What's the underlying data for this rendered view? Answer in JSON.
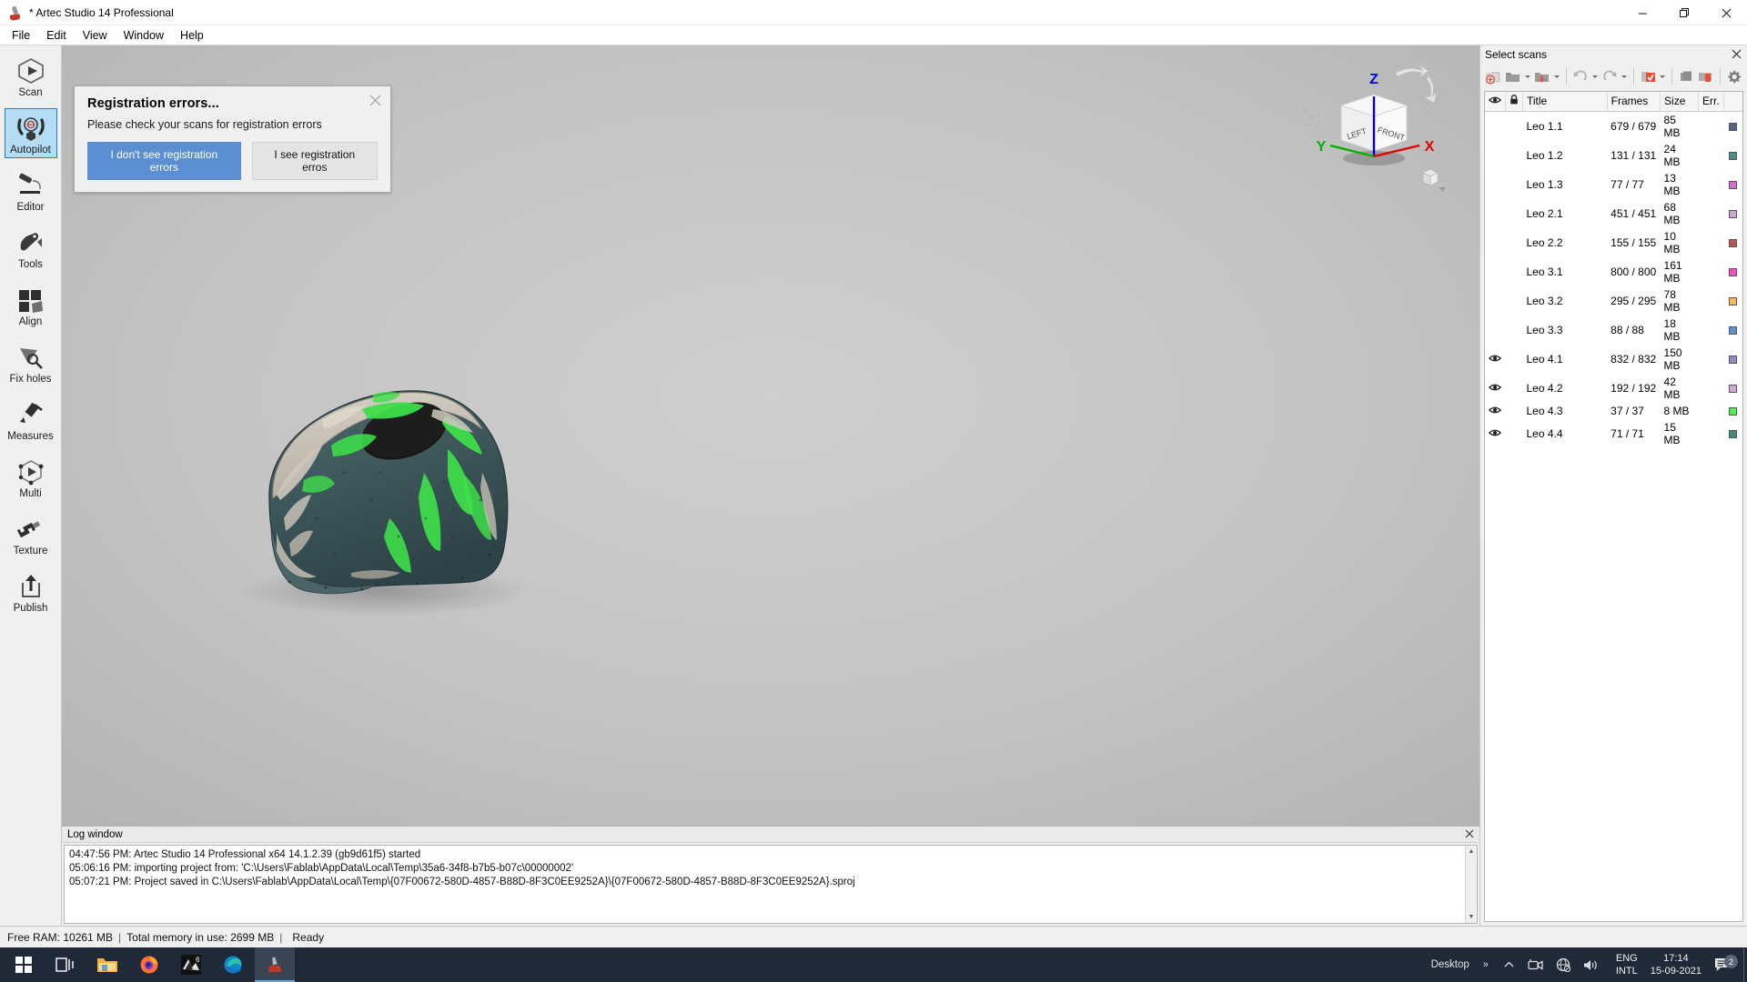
{
  "window": {
    "title": "* Artec Studio 14 Professional",
    "icon": "artec-app-icon",
    "controls": {
      "minimize": "—",
      "maximize": "❐",
      "close": "✕"
    }
  },
  "menubar": {
    "items": [
      "File",
      "Edit",
      "View",
      "Window",
      "Help"
    ]
  },
  "sidebar": {
    "items": [
      {
        "label": "Scan",
        "icon": "scan-icon",
        "active": false
      },
      {
        "label": "Autopilot",
        "icon": "autopilot-icon",
        "active": true
      },
      {
        "label": "Editor",
        "icon": "editor-icon",
        "active": false
      },
      {
        "label": "Tools",
        "icon": "tools-icon",
        "active": false
      },
      {
        "label": "Align",
        "icon": "align-icon",
        "active": false
      },
      {
        "label": "Fix holes",
        "icon": "fix-holes-icon",
        "active": false
      },
      {
        "label": "Measures",
        "icon": "measures-icon",
        "active": false
      },
      {
        "label": "Multi",
        "icon": "multi-icon",
        "active": false
      },
      {
        "label": "Texture",
        "icon": "texture-icon",
        "active": false
      },
      {
        "label": "Publish",
        "icon": "publish-icon",
        "active": false
      }
    ]
  },
  "toast": {
    "title": "Registration errors...",
    "message": "Please check your scans for registration errors",
    "primary_button": "I don't see registration errors",
    "secondary_button": "I see registration erros",
    "close_icon": "close-icon",
    "primary_color": "#5b8fd1"
  },
  "gizmo": {
    "axis_x": "X",
    "axis_y": "Y",
    "axis_z": "Z",
    "face_left": "LEFT",
    "face_front": "FRONT",
    "axis_x_color": "#e00000",
    "axis_y_color": "#00b000",
    "axis_z_color": "#0000d8"
  },
  "scan_panel": {
    "title": "Select scans",
    "close_icon": "close-icon",
    "toolbar": [
      {
        "name": "add-scan-icon"
      },
      {
        "name": "open-folder-icon",
        "caret": true
      },
      {
        "name": "import-icon",
        "caret": true
      },
      {
        "name": "undo-icon",
        "caret": true
      },
      {
        "name": "redo-icon",
        "caret": true
      },
      {
        "name": "select-all-icon",
        "caret": true
      },
      {
        "name": "duplicate-icon"
      },
      {
        "name": "delete-icon"
      },
      {
        "name": "settings-gear-icon"
      }
    ],
    "columns": [
      "",
      "",
      "Title",
      "Frames",
      "Size",
      "Err.",
      ""
    ],
    "rows": [
      {
        "visible": false,
        "locked": false,
        "title": "Leo 1.1",
        "frames": "679 / 679",
        "size": "85 MB",
        "err": "",
        "color": "#5c5f8c"
      },
      {
        "visible": false,
        "locked": false,
        "title": "Leo 1.2",
        "frames": "131 / 131",
        "size": "24 MB",
        "err": "",
        "color": "#4c8a85"
      },
      {
        "visible": false,
        "locked": false,
        "title": "Leo 1.3",
        "frames": "77 / 77",
        "size": "13 MB",
        "err": "",
        "color": "#d06fd0"
      },
      {
        "visible": false,
        "locked": false,
        "title": "Leo 2.1",
        "frames": "451 / 451",
        "size": "68 MB",
        "err": "",
        "color": "#cda7d6"
      },
      {
        "visible": false,
        "locked": false,
        "title": "Leo 2.2",
        "frames": "155 / 155",
        "size": "10 MB",
        "err": "",
        "color": "#b55a4f"
      },
      {
        "visible": false,
        "locked": false,
        "title": "Leo 3.1",
        "frames": "800 / 800",
        "size": "161 MB",
        "err": "",
        "color": "#f84fc0"
      },
      {
        "visible": false,
        "locked": false,
        "title": "Leo 3.2",
        "frames": "295 / 295",
        "size": "78 MB",
        "err": "",
        "color": "#f5ba58"
      },
      {
        "visible": false,
        "locked": false,
        "title": "Leo 3.3",
        "frames": "88 / 88",
        "size": "18 MB",
        "err": "",
        "color": "#5b92c9"
      },
      {
        "visible": true,
        "locked": false,
        "title": "Leo 4.1",
        "frames": "832 / 832",
        "size": "150 MB",
        "err": "",
        "color": "#8e8ec4"
      },
      {
        "visible": true,
        "locked": false,
        "title": "Leo 4.2",
        "frames": "192 / 192",
        "size": "42 MB",
        "err": "",
        "color": "#d6a6d6"
      },
      {
        "visible": true,
        "locked": false,
        "title": "Leo 4.3",
        "frames": "37 / 37",
        "size": "8 MB",
        "err": "",
        "color": "#4cf24c"
      },
      {
        "visible": true,
        "locked": false,
        "title": "Leo 4.4",
        "frames": "71 / 71",
        "size": "15 MB",
        "err": "",
        "color": "#3d8a7e"
      }
    ]
  },
  "log_window": {
    "title": "Log window",
    "close_icon": "close-icon",
    "lines": [
      "04:47:56 PM: Artec Studio 14 Professional x64 14.1.2.39 (gb9d61f5) started",
      "05:06:16 PM: importing project from: 'C:\\Users\\Fablab\\AppData\\Local\\Temp\\35a6-34f8-b7b5-b07c\\00000002'",
      "05:07:21 PM: Project saved in C:\\Users\\Fablab\\AppData\\Local\\Temp\\{07F00672-580D-4857-B88D-8F3C0EE9252A}\\{07F00672-580D-4857-B88D-8F3C0EE9252A}.sproj"
    ]
  },
  "statusbar": {
    "free_ram": "Free RAM: 10261 MB",
    "total_memory": "Total memory in use: 2699 MB",
    "state": "Ready",
    "separator": "|"
  },
  "taskbar": {
    "apps": [
      {
        "name": "start-windows-icon"
      },
      {
        "name": "task-view-icon"
      },
      {
        "name": "file-explorer-icon"
      },
      {
        "name": "firefox-icon"
      },
      {
        "name": "cura-icon",
        "badge": "6"
      },
      {
        "name": "edge-icon"
      },
      {
        "name": "artec-studio-icon",
        "active": true
      }
    ],
    "tray": {
      "desktop_label": "Desktop",
      "overflow_icon": "chevron-up-icon",
      "camera_icon": "camera-icon",
      "network_icon": "network-offline-icon",
      "volume_icon": "volume-icon",
      "language_line1": "ENG",
      "language_line2": "INTL",
      "time": "17:14",
      "date": "15-09-2021",
      "notification_icon": "notification-icon",
      "notification_count": "2"
    }
  }
}
